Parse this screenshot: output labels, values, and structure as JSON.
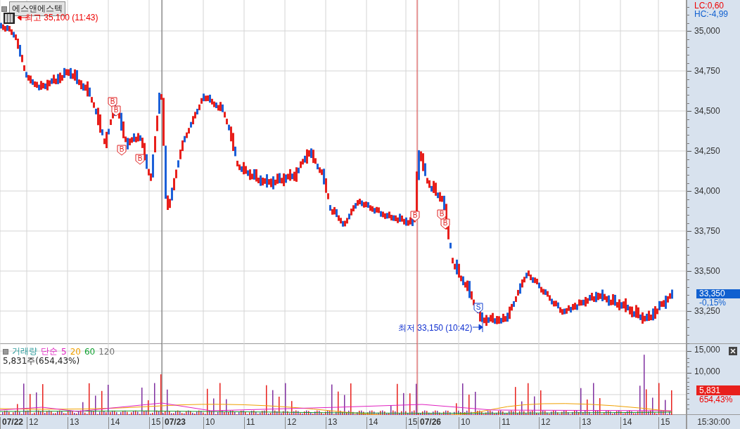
{
  "stock": {
    "name": "에스앤에스텍"
  },
  "high_label": {
    "text": "최고 35,100 (11:43)"
  },
  "low_label": {
    "text": "최저 33,150 (10:42)"
  },
  "markers": [
    {
      "kind": "buy",
      "text": "B"
    },
    {
      "kind": "buy",
      "text": "B"
    },
    {
      "kind": "buy",
      "text": "B"
    },
    {
      "kind": "buy",
      "text": "B"
    },
    {
      "kind": "buy",
      "text": "B"
    },
    {
      "kind": "buy",
      "text": "B"
    },
    {
      "kind": "buy",
      "text": "B"
    },
    {
      "kind": "sell",
      "text": "S"
    }
  ],
  "price_axis": {
    "lc": "LC:0,60",
    "hc": "HC:-4,99",
    "ticks": [
      "35,000",
      "34,750",
      "34,500",
      "34,250",
      "34,000",
      "33,750",
      "33,500",
      "33,250"
    ],
    "current_price": "33,350",
    "change": "-0,15%"
  },
  "volume": {
    "title": "거래량",
    "ma_type": "단순",
    "legend": [
      {
        "text": "5",
        "color": "#e020c0"
      },
      {
        "text": "20",
        "color": "#f0a000"
      },
      {
        "text": "60",
        "color": "#10a030"
      },
      {
        "text": "120",
        "color": "#707070"
      }
    ],
    "summary": "5,831주(654,43%)",
    "ticks": [
      "15,000",
      "10,000"
    ],
    "current": "5,831",
    "ratio": "654,43%"
  },
  "time_axis": {
    "labels": [
      {
        "text": "07/22",
        "kind": "date"
      },
      {
        "text": "12",
        "kind": "hour"
      },
      {
        "text": "13",
        "kind": "hour"
      },
      {
        "text": "14",
        "kind": "hour"
      },
      {
        "text": "15",
        "kind": "hour"
      },
      {
        "text": "07/23",
        "kind": "date"
      },
      {
        "text": "10",
        "kind": "hour"
      },
      {
        "text": "11",
        "kind": "hour"
      },
      {
        "text": "12",
        "kind": "hour"
      },
      {
        "text": "13",
        "kind": "hour"
      },
      {
        "text": "14",
        "kind": "hour"
      },
      {
        "text": "15",
        "kind": "hour"
      },
      {
        "text": "07/26",
        "kind": "date"
      },
      {
        "text": "10",
        "kind": "hour"
      },
      {
        "text": "11",
        "kind": "hour"
      },
      {
        "text": "12",
        "kind": "hour"
      },
      {
        "text": "13",
        "kind": "hour"
      },
      {
        "text": "14",
        "kind": "hour"
      },
      {
        "text": "15",
        "kind": "hour"
      }
    ],
    "end_time": "15:30:00"
  }
}
